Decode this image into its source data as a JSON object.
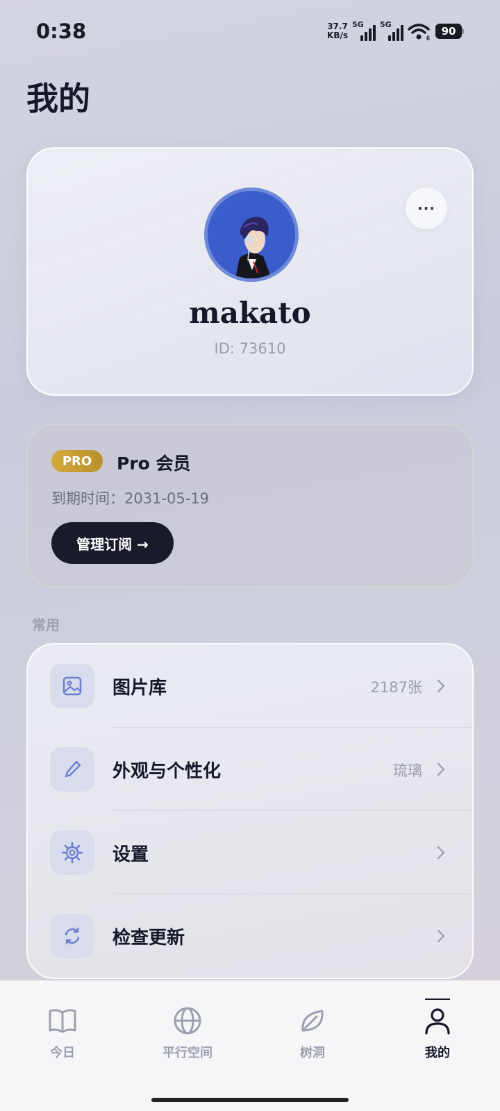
{
  "status": {
    "time": "0:38",
    "net_speed_value": "37.7",
    "net_speed_unit": "KB/s",
    "sim1": "5G",
    "sim2": "5G",
    "wifi_sub": "6",
    "battery": "90"
  },
  "page": {
    "title": "我的"
  },
  "profile": {
    "username": "makato",
    "id_text": "ID: 73610",
    "more_label": "···"
  },
  "subscription": {
    "badge": "PRO",
    "title": "Pro 会员",
    "expiry": "到期时间：2031-05-19",
    "manage_label": "管理订阅 →",
    "badge_color": "#c9a035"
  },
  "section": {
    "label": "常用"
  },
  "menu": {
    "items": [
      {
        "label": "图片库",
        "value": "2187张",
        "icon": "image-icon"
      },
      {
        "label": "外观与个性化",
        "value": "琉璃",
        "icon": "brush-icon"
      },
      {
        "label": "设置",
        "value": "",
        "icon": "gear-icon"
      },
      {
        "label": "检查更新",
        "value": "",
        "icon": "refresh-icon"
      }
    ]
  },
  "tabs": [
    {
      "label": "今日",
      "icon": "book-icon"
    },
    {
      "label": "平行空间",
      "icon": "globe-icon"
    },
    {
      "label": "树洞",
      "icon": "leaf-icon"
    },
    {
      "label": "我的",
      "icon": "person-icon",
      "active": true
    }
  ],
  "colors": {
    "accent": "#6b7fd0",
    "dark": "#191b2b"
  }
}
